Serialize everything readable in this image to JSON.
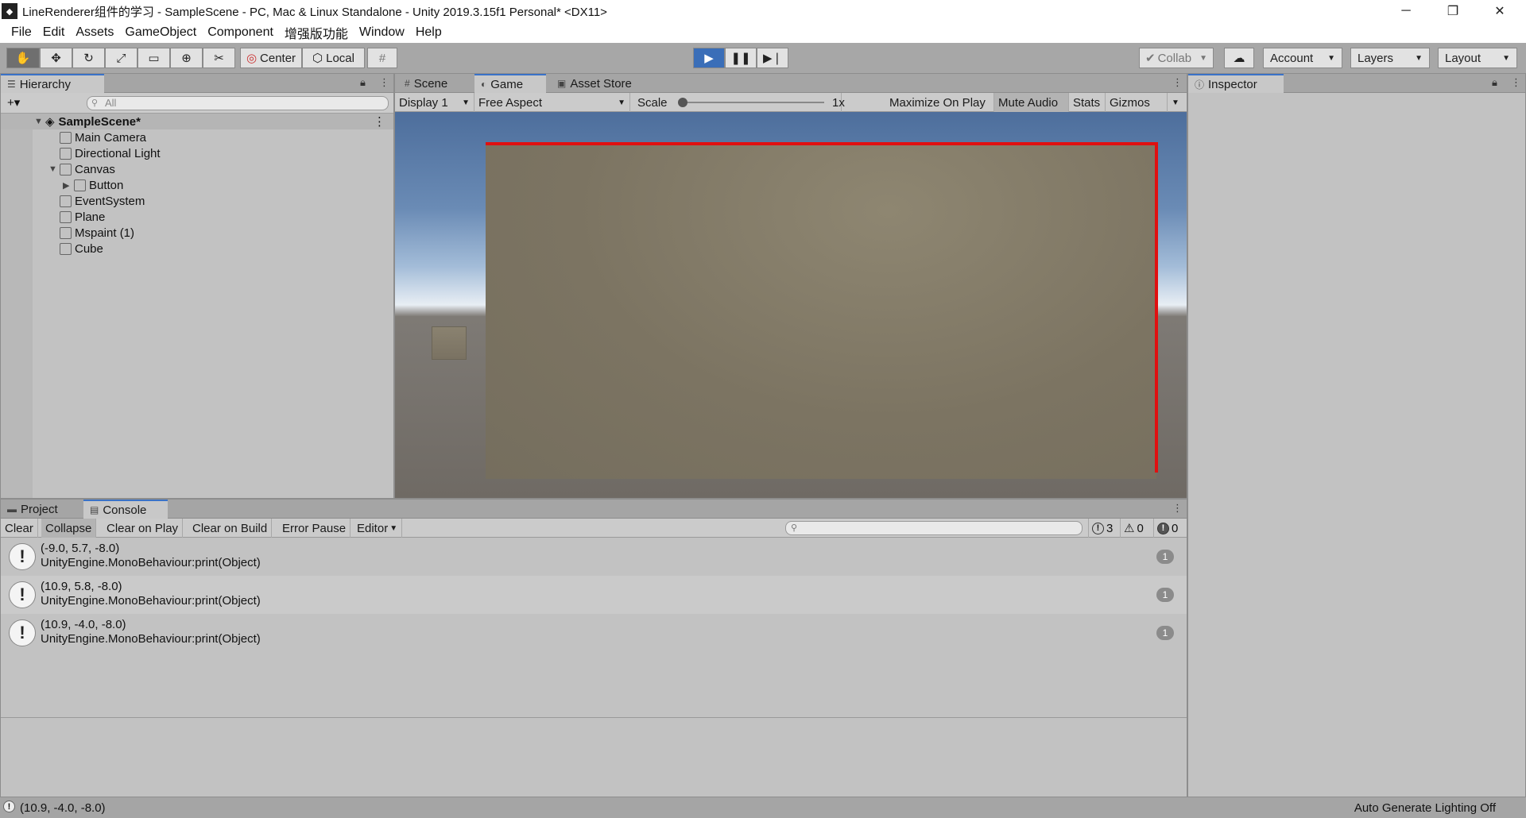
{
  "window": {
    "title": "LineRenderer组件的学习 - SampleScene - PC, Mac & Linux Standalone - Unity 2019.3.15f1 Personal* <DX11>",
    "minimize": "─",
    "maximize": "❐",
    "close": "✕"
  },
  "menu": [
    "File",
    "Edit",
    "Assets",
    "GameObject",
    "Component",
    "增强版功能",
    "Window",
    "Help"
  ],
  "toolbar": {
    "pivot_center": "Center",
    "pivot_local": "Local",
    "collab": "Collab",
    "account": "Account",
    "layers": "Layers",
    "layout": "Layout"
  },
  "hierarchy": {
    "tab": "Hierarchy",
    "add": "+▾",
    "search_placeholder": "All",
    "scene": "SampleScene*",
    "items": [
      "Main Camera",
      "Directional Light",
      "Canvas",
      "Button",
      "EventSystem",
      "Plane",
      "Mspaint (1)",
      "Cube"
    ]
  },
  "center_tabs": {
    "scene": "Scene",
    "game": "Game",
    "asset_store": "Asset Store"
  },
  "game": {
    "display": "Display 1",
    "aspect": "Free Aspect",
    "scale_label": "Scale",
    "scale_value": "1x",
    "maximize": "Maximize On Play",
    "mute": "Mute Audio",
    "stats": "Stats",
    "gizmos": "Gizmos"
  },
  "inspector": {
    "tab": "Inspector"
  },
  "bottom_tabs": {
    "project": "Project",
    "console": "Console"
  },
  "console": {
    "clear": "Clear",
    "collapse": "Collapse",
    "clear_on_play": "Clear on Play",
    "clear_on_build": "Clear on Build",
    "error_pause": "Error Pause",
    "editor": "Editor",
    "log_count": "3",
    "warn_count": "0",
    "error_count": "0",
    "entries": [
      {
        "line1": "(-9.0, 5.7, -8.0)",
        "line2": "UnityEngine.MonoBehaviour:print(Object)",
        "count": "1"
      },
      {
        "line1": "(10.9, 5.8, -8.0)",
        "line2": "UnityEngine.MonoBehaviour:print(Object)",
        "count": "1"
      },
      {
        "line1": "(10.9, -4.0, -8.0)",
        "line2": "UnityEngine.MonoBehaviour:print(Object)",
        "count": "1"
      }
    ]
  },
  "status": {
    "last_log": "(10.9, -4.0, -8.0)",
    "lighting": "Auto Generate Lighting Off"
  },
  "colors": {
    "line_renderer": "#e01010",
    "play_active": "#3a6eb8",
    "tab_accent": "#3a72c8"
  }
}
